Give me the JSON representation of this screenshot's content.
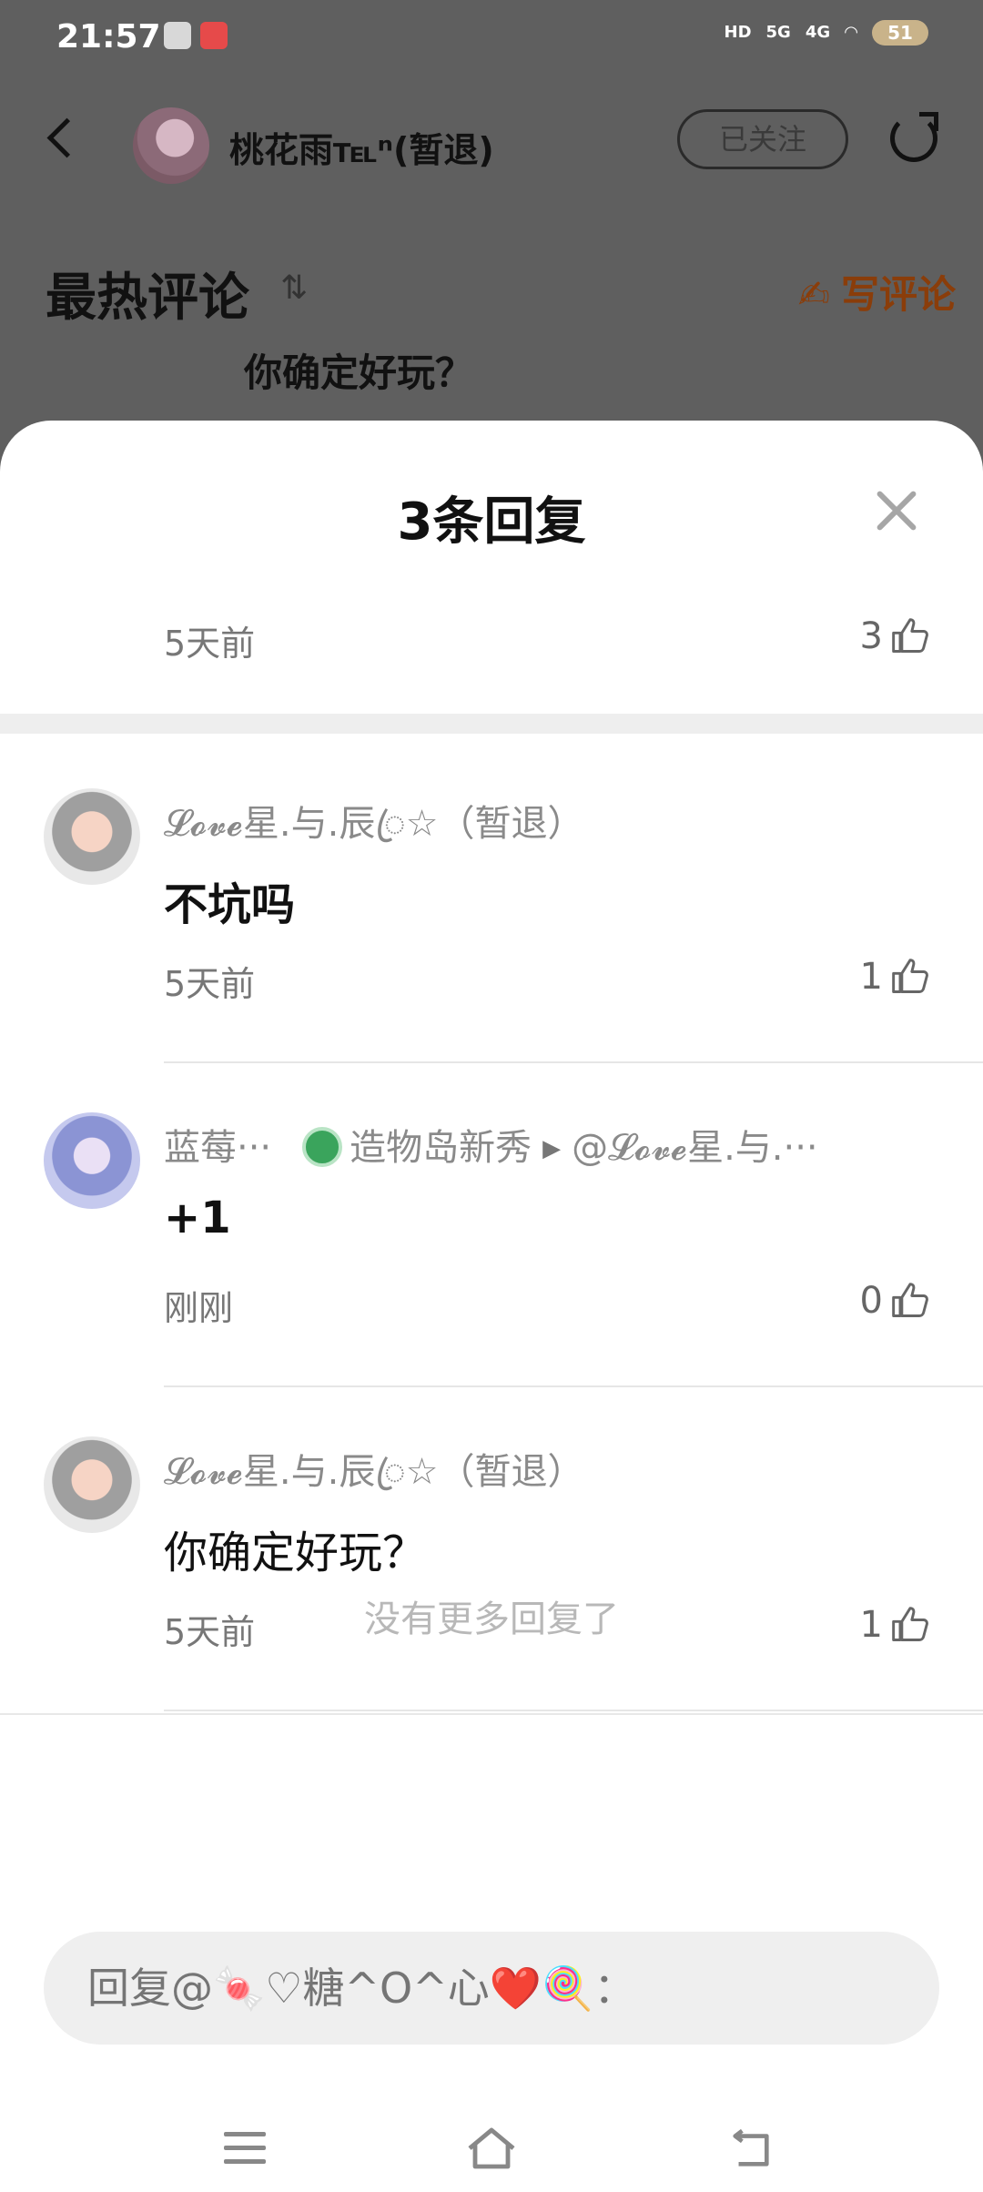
{
  "status_bar": {
    "time": "21:57",
    "network_5g": "5G",
    "network_4g": "4G",
    "hd_label": "HD",
    "battery": "51"
  },
  "header": {
    "author_name": "桃花雨℡ⁿ(暂退)",
    "follow_label": "已关注",
    "back_icon": "chevron-left-icon",
    "share_icon": "share-icon"
  },
  "comments_section": {
    "title": "最热评论",
    "sort_icon": "⇅",
    "write_comment_label": "写评论",
    "peek_text": "你确定好玩？"
  },
  "sheet": {
    "title": "3条回复",
    "parent_meta": {
      "time": "5天前",
      "likes": "3"
    },
    "replies": [
      {
        "user": "𝓛𝓸𝓿𝓮星.与.辰ꦿ☆（暂退）",
        "content": "不坑吗",
        "time": "5天前",
        "likes": "1"
      },
      {
        "user": "蓝莓···",
        "badge": "造物岛新秀",
        "reply_to": "@𝓛𝓸𝓿𝓮星.与.···",
        "content": "+1",
        "time": "刚刚",
        "likes": "0"
      },
      {
        "user": "𝓛𝓸𝓿𝓮星.与.辰ꦿ☆（暂退）",
        "content": "你确定好玩？",
        "time": "5天前",
        "likes": "1"
      }
    ],
    "no_more": "没有更多回复了",
    "input_placeholder": "回复@🍬♡糖^O^心❤️🍭："
  },
  "colors": {
    "accent": "#8a3d0a",
    "badge_green": "#3aa45c",
    "overlay": "#5f5f5f"
  }
}
